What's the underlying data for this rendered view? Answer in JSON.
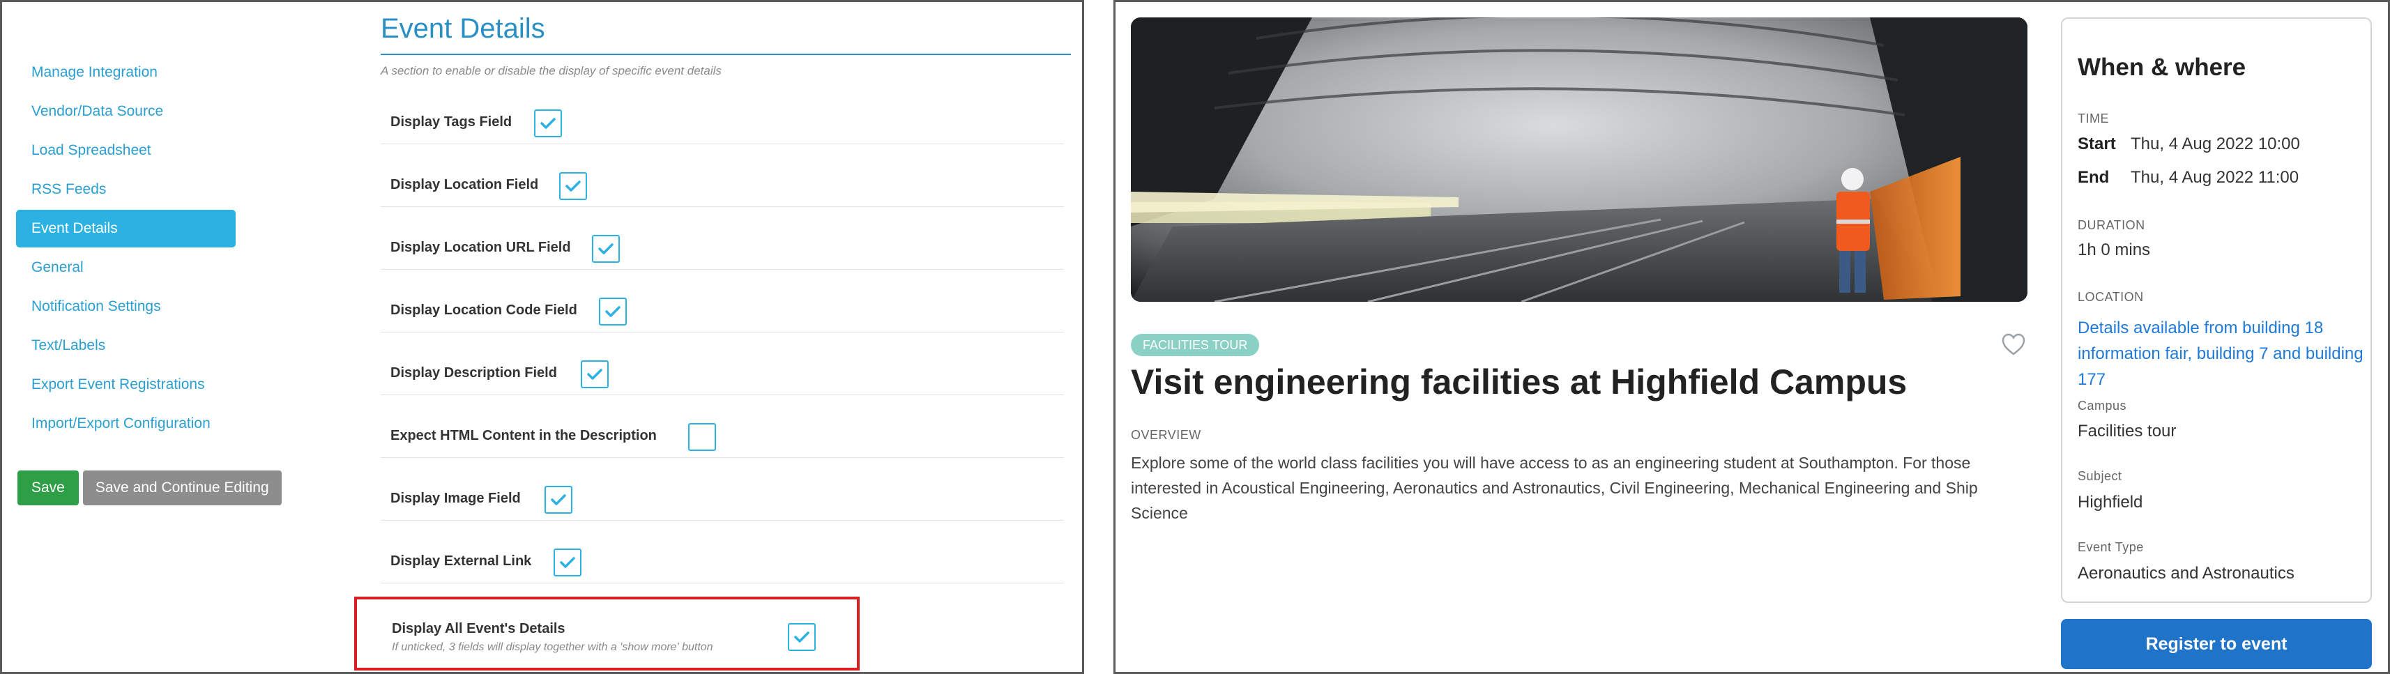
{
  "admin": {
    "sidebar": {
      "items": [
        {
          "label": "Manage Integration",
          "active": false
        },
        {
          "label": "Vendor/Data Source",
          "active": false
        },
        {
          "label": "Load Spreadsheet",
          "active": false
        },
        {
          "label": "RSS Feeds",
          "active": false
        },
        {
          "label": "Event Details",
          "active": true
        },
        {
          "label": "General",
          "active": false
        },
        {
          "label": "Notification Settings",
          "active": false
        },
        {
          "label": "Text/Labels",
          "active": false
        },
        {
          "label": "Export Event Registrations",
          "active": false
        },
        {
          "label": "Import/Export Configuration",
          "active": false
        }
      ],
      "save_label": "Save",
      "save_continue_label": "Save and Continue Editing"
    },
    "section": {
      "title": "Event Details",
      "description": "A section to enable or disable the display of specific event details",
      "fields": [
        {
          "label": "Display Tags Field",
          "checked": true
        },
        {
          "label": "Display Location Field",
          "checked": true
        },
        {
          "label": "Display Location URL Field",
          "checked": true
        },
        {
          "label": "Display Location Code Field",
          "checked": true
        },
        {
          "label": "Display Description Field",
          "checked": true
        },
        {
          "label": "Expect HTML Content in the Description",
          "checked": false
        },
        {
          "label": "Display Image Field",
          "checked": true
        },
        {
          "label": "Display External Link",
          "checked": true
        }
      ],
      "highlighted_field": {
        "label": "Display All Event's Details",
        "hint": "If unticked, 3 fields will display together with a 'show more' button",
        "checked": true
      }
    }
  },
  "event": {
    "tag": "FACILITIES TOUR",
    "title": "Visit engineering facilities at Highfield Campus",
    "overview_label": "OVERVIEW",
    "overview_text": "Explore some of the world class facilities you will have access to as an engineering student at Southampton. For those interested in Acoustical Engineering, Aeronautics and Astronautics, Civil Engineering, Mechanical Engineering and Ship Science",
    "info": {
      "title": "When & where",
      "time_label": "TIME",
      "start_key": "Start",
      "start_value": "Thu, 4 Aug 2022 10:00",
      "end_key": "End",
      "end_value": "Thu, 4 Aug 2022 11:00",
      "duration_label": "DURATION",
      "duration_value": "1h 0 mins",
      "location_label": "LOCATION",
      "location_value": "Details available from building 18 information fair, building 7 and building 177",
      "campus_label": "Campus",
      "campus_value": "Facilities tour",
      "subject_label": "Subject",
      "subject_value": "Highfield",
      "event_type_label": "Event Type",
      "event_type_value": "Aeronautics and Astronautics"
    },
    "register_label": "Register to event"
  },
  "colors": {
    "accent": "#2bb2e3",
    "save": "#2e9e47",
    "secondary_button": "#8d8d8d",
    "highlight_border": "#d82020",
    "tag": "#8ad0c4",
    "link": "#1e7ad6",
    "register": "#1f73c9"
  }
}
